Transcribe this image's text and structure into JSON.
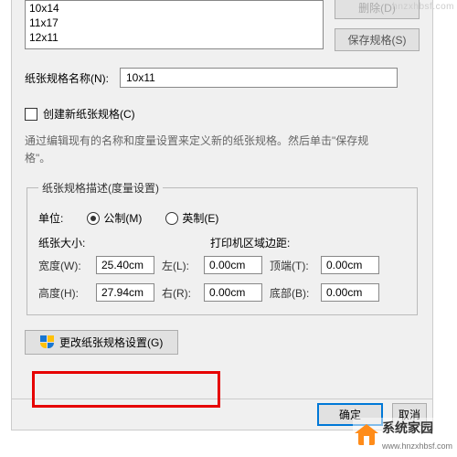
{
  "list": {
    "items": [
      "10x14",
      "11x17",
      "12x11"
    ]
  },
  "buttons": {
    "delete": "删除(D)",
    "save_spec": "保存规格(S)",
    "change_settings": "更改纸张规格设置(G)",
    "ok": "确定",
    "cancel": "取消"
  },
  "labels": {
    "spec_name": "纸张规格名称(N):",
    "create_new": "创建新纸张规格(C)",
    "help_text": "通过编辑现有的名称和度量设置来定义新的纸张规格。然后单击\"保存规格\"。",
    "fieldset_legend": "纸张规格描述(度量设置)",
    "unit": "单位:",
    "metric": "公制(M)",
    "imperial": "英制(E)",
    "paper_size": "纸张大小:",
    "printer_margin": "打印机区域边距:",
    "width": "宽度(W):",
    "height": "高度(H):",
    "left": "左(L):",
    "right": "右(R):",
    "top": "顶端(T):",
    "bottom": "底部(B):"
  },
  "values": {
    "spec_name": "10x11",
    "width": "25.40cm",
    "height": "27.94cm",
    "left": "0.00cm",
    "right": "0.00cm",
    "top": "0.00cm",
    "bottom": "0.00cm"
  },
  "watermark": {
    "top": "hnzxhbsf.com",
    "name": "系统家园",
    "url": "www.hnzxhbsf.com"
  }
}
